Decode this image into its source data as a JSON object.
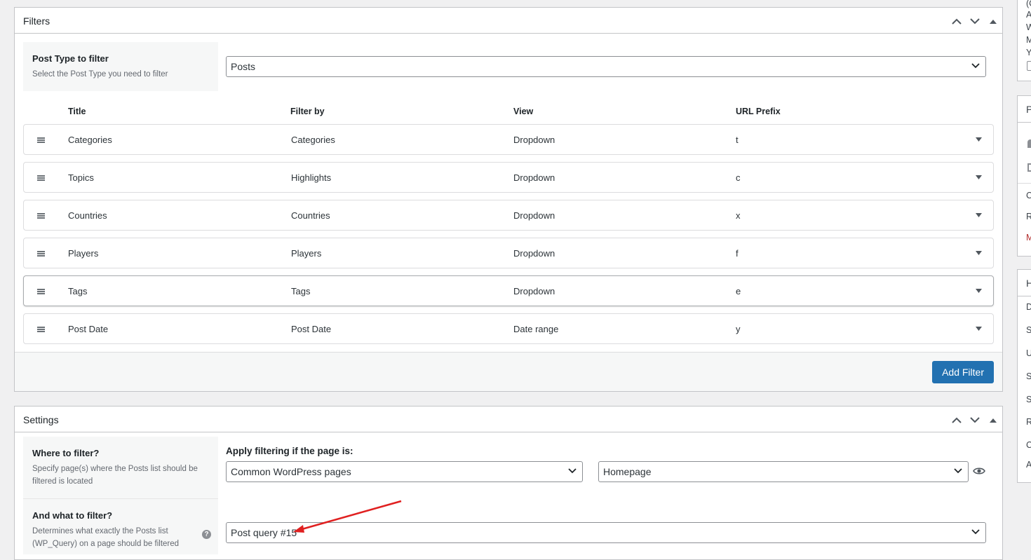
{
  "filters_panel": {
    "title": "Filters",
    "post_type": {
      "label": "Post Type to filter",
      "description": "Select the Post Type you need to filter",
      "selected": "Posts"
    },
    "columns": [
      "Title",
      "Filter by",
      "View",
      "URL Prefix"
    ],
    "rows": [
      {
        "title": "Categories",
        "filter_by": "Categories",
        "view": "Dropdown",
        "prefix": "t"
      },
      {
        "title": "Topics",
        "filter_by": "Highlights",
        "view": "Dropdown",
        "prefix": "c"
      },
      {
        "title": "Countries",
        "filter_by": "Countries",
        "view": "Dropdown",
        "prefix": "x"
      },
      {
        "title": "Players",
        "filter_by": "Players",
        "view": "Dropdown",
        "prefix": "f"
      },
      {
        "title": "Tags",
        "filter_by": "Tags",
        "view": "Dropdown",
        "prefix": "e"
      },
      {
        "title": "Post Date",
        "filter_by": "Post Date",
        "view": "Date range",
        "prefix": "y"
      }
    ],
    "add_filter_label": "Add Filter"
  },
  "settings_panel": {
    "title": "Settings",
    "where": {
      "label": "Where to filter?",
      "description": "Specify page(s) where the Posts list should be filtered is located"
    },
    "apply_label": "Apply filtering if the page is:",
    "page_type_selected": "Common WordPress pages",
    "page_selected": "Homepage",
    "what": {
      "label": "And what to filter?",
      "description": "Determines what exactly the Posts list (WP_Query) on a page should be filtered"
    },
    "query_selected": "Post query #15"
  },
  "right_sidebar": {
    "top_letters": [
      "(C",
      "A",
      "W",
      "M",
      "Y"
    ],
    "panel2_header": "P",
    "panel2_items": [
      "C",
      "R",
      "M"
    ],
    "panel3_header": "H",
    "panel3_items": [
      "D",
      "S",
      "U",
      "S",
      "S",
      "R",
      "C",
      "A"
    ]
  },
  "colors": {
    "primary": "#2271b1",
    "annotation_arrow": "#e02020",
    "danger_text": "#b32d2e"
  }
}
